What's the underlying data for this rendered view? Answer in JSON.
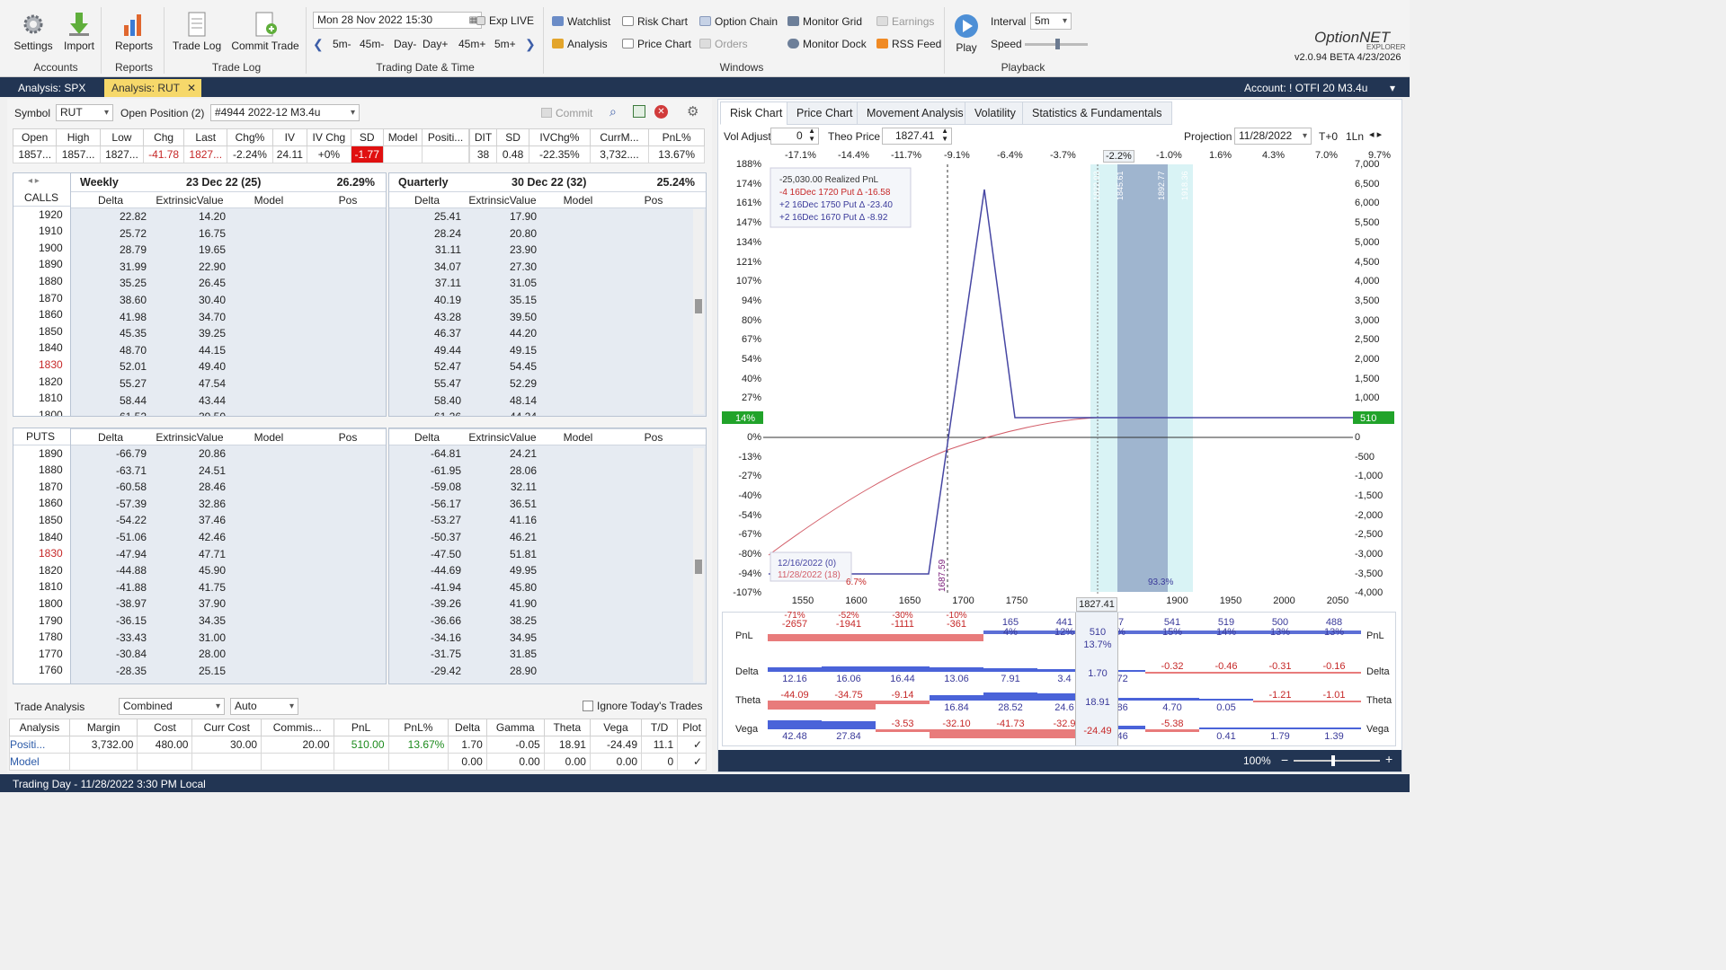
{
  "ribbon": {
    "settings": "Settings",
    "import": "Import",
    "reports": "Reports",
    "trade_log": "Trade Log",
    "commit_trade": "Commit Trade",
    "grp_accounts": "Accounts",
    "grp_reports": "Reports",
    "grp_tradelog": "Trade Log",
    "grp_datetime": "Trading Date & Time",
    "grp_windows": "Windows",
    "grp_playback": "Playback",
    "datetime": "Mon 28 Nov 2022 15:30",
    "exp_live": "Exp LIVE",
    "steps": [
      "5m-",
      "45m-",
      "Day-",
      "Day+",
      "45m+",
      "5m+"
    ],
    "watchlist": "Watchlist",
    "risk_chart": "Risk Chart",
    "option_chain": "Option Chain",
    "monitor_grid": "Monitor Grid",
    "earnings": "Earnings",
    "analysis": "Analysis",
    "price_chart": "Price Chart",
    "orders": "Orders",
    "monitor_dock": "Monitor Dock",
    "rss_feed": "RSS Feed",
    "play": "Play",
    "interval_label": "Interval",
    "interval_value": "5m",
    "speed_label": "Speed",
    "logo": "OptionNET",
    "logo_sub": "EXPLORER",
    "version": "v2.0.94 BETA 4/23/2026"
  },
  "doc_tabs": {
    "tab1": "Analysis: SPX",
    "tab2": "Analysis: RUT",
    "close": "✕",
    "account": "Account: ! OTFI 20 M3.4u"
  },
  "top": {
    "symbol_label": "Symbol",
    "symbol_value": "RUT",
    "open_pos_label": "Open Position (2)",
    "open_pos_value": "#4944 2022-12 M3.4u",
    "commit": "Commit"
  },
  "quote": {
    "headers": [
      "Open",
      "High",
      "Low",
      "Chg",
      "Last",
      "Chg%",
      "IV",
      "IV Chg",
      "SD",
      "Model",
      "Positi..."
    ],
    "values": [
      "1857...",
      "1857...",
      "1827...",
      "-41.78",
      "1827...",
      "-2.24%",
      "24.11",
      "+0%",
      "-1.77",
      "",
      ""
    ],
    "headers2": [
      "DIT",
      "SD",
      "IVChg%",
      "CurrM...",
      "PnL%"
    ],
    "values2": [
      "38",
      "0.48",
      "-22.35%",
      "3,732....",
      "13.67%"
    ]
  },
  "chain": {
    "weekly_label": "Weekly",
    "weekly_date": "23 Dec 22 (25)",
    "weekly_iv": "26.29%",
    "quarterly_label": "Quarterly",
    "quarterly_date": "30 Dec 22 (32)",
    "quarterly_iv": "25.24%",
    "calls_label": "CALLS",
    "puts_label": "PUTS",
    "col_delta": "Delta",
    "col_extrinsic": "ExtrinsicValue",
    "col_model": "Model",
    "col_pos": "Pos",
    "call_strikes": [
      "1920",
      "1910",
      "1900",
      "1890",
      "1880",
      "1870",
      "1860",
      "1850",
      "1840",
      "1830",
      "1820",
      "1810",
      "1800"
    ],
    "call_w_delta": [
      "22.82",
      "25.72",
      "28.79",
      "31.99",
      "35.25",
      "38.60",
      "41.98",
      "45.35",
      "48.70",
      "52.01",
      "55.27",
      "58.44",
      "61.52"
    ],
    "call_w_ext": [
      "14.20",
      "16.75",
      "19.65",
      "22.90",
      "26.45",
      "30.40",
      "34.70",
      "39.25",
      "44.15",
      "49.40",
      "47.54",
      "43.44",
      "39.50"
    ],
    "call_q_delta": [
      "25.41",
      "28.24",
      "31.11",
      "34.07",
      "37.11",
      "40.19",
      "43.28",
      "46.37",
      "49.44",
      "52.47",
      "55.47",
      "58.40",
      "61.26"
    ],
    "call_q_ext": [
      "17.90",
      "20.80",
      "23.90",
      "27.30",
      "31.05",
      "35.15",
      "39.50",
      "44.20",
      "49.15",
      "54.45",
      "52.29",
      "48.14",
      "44.24"
    ],
    "put_strikes": [
      "1890",
      "1880",
      "1870",
      "1860",
      "1850",
      "1840",
      "1830",
      "1820",
      "1810",
      "1800",
      "1790",
      "1780",
      "1770",
      "1760"
    ],
    "put_w_delta": [
      "-66.79",
      "-63.71",
      "-60.58",
      "-57.39",
      "-54.22",
      "-51.06",
      "-47.94",
      "-44.88",
      "-41.88",
      "-38.97",
      "-36.15",
      "-33.43",
      "-30.84",
      "-28.35"
    ],
    "put_w_ext": [
      "20.86",
      "24.51",
      "28.46",
      "32.86",
      "37.46",
      "42.46",
      "47.71",
      "45.90",
      "41.75",
      "37.90",
      "34.35",
      "31.00",
      "28.00",
      "25.15"
    ],
    "put_q_delta": [
      "-64.81",
      "-61.95",
      "-59.08",
      "-56.17",
      "-53.27",
      "-50.37",
      "-47.50",
      "-44.69",
      "-41.94",
      "-39.26",
      "-36.66",
      "-34.16",
      "-31.75",
      "-29.42"
    ],
    "put_q_ext": [
      "24.21",
      "28.06",
      "32.11",
      "36.51",
      "41.16",
      "46.21",
      "51.81",
      "49.95",
      "45.80",
      "41.90",
      "38.25",
      "34.95",
      "31.85",
      "28.90"
    ]
  },
  "trade_analysis": {
    "label": "Trade Analysis",
    "mode": "Combined",
    "auto": "Auto",
    "ignore": "Ignore Today's Trades",
    "headers": [
      "Analysis",
      "Margin",
      "Cost",
      "Curr Cost",
      "Commis...",
      "PnL",
      "PnL%",
      "Delta",
      "Gamma",
      "Theta",
      "Vega",
      "T/D",
      "Plot"
    ],
    "row1": [
      "Positi...",
      "3,732.00",
      "480.00",
      "30.00",
      "20.00",
      "510.00",
      "13.67%",
      "1.70",
      "-0.05",
      "18.91",
      "-24.49",
      "11.1",
      "✓"
    ],
    "row2": [
      "Model",
      "",
      "",
      "",
      "",
      "",
      "",
      "0.00",
      "0.00",
      "0.00",
      "0.00",
      "0",
      "✓"
    ]
  },
  "right_tabs": [
    "Risk Chart",
    "Price Chart",
    "Movement Analysis",
    "Volatility",
    "Statistics & Fundamentals"
  ],
  "risk": {
    "vol_adjust": "Vol Adjust",
    "vol_value": "0",
    "theo_label": "Theo Price",
    "theo_value": "1827.41",
    "projection_label": "Projection",
    "projection_value": "11/28/2022",
    "t0": "T+0",
    "lines": "1Ln",
    "top_pct": [
      "-17.1%",
      "-14.4%",
      "-11.7%",
      "-9.1%",
      "-6.4%",
      "-3.7%",
      "-2.2%",
      "-1.0%",
      "1.6%",
      "4.3%",
      "7.0%",
      "9.7%"
    ],
    "left_pct": [
      "188%",
      "174%",
      "161%",
      "147%",
      "134%",
      "121%",
      "107%",
      "94%",
      "80%",
      "67%",
      "54%",
      "40%",
      "27%",
      "14%",
      "0%",
      "-13%",
      "-27%",
      "-40%",
      "-54%",
      "-67%",
      "-80%",
      "-94%",
      "-107%"
    ],
    "right_vals": [
      "7,000",
      "6,500",
      "6,000",
      "5,500",
      "5,000",
      "4,500",
      "4,000",
      "3,500",
      "3,000",
      "2,500",
      "2,000",
      "1,500",
      "1,000",
      "510",
      "0",
      "-500",
      "-1,000",
      "-1,500",
      "-2,000",
      "-2,500",
      "-3,000",
      "-3,500",
      "-4,000"
    ],
    "x_labels": [
      "1550",
      "1600",
      "1650",
      "1700",
      "1750",
      "1800",
      "1850",
      "1900",
      "1950",
      "2000",
      "2050"
    ],
    "legend": [
      "-25,030.00 Realized PnL",
      "-4 16Dec 1720 Put Δ -16.58",
      "+2 16Dec 1750 Put Δ -23.40",
      "+2 16Dec 1670 Put Δ -8.92"
    ],
    "date_legend": [
      "12/16/2022 (0)",
      "11/28/2022 (18)"
    ],
    "price_marker": "1827.41",
    "bottom_left_pct": "6.7%",
    "bottom_right_pct": "93.3%",
    "breakeven": "1687.59",
    "vertical_prices": [
      "1822.03",
      "1845.61",
      "1892.77",
      "1918.36"
    ],
    "current_pnl": "510",
    "current_pct": "14%"
  },
  "greeks": {
    "labels": [
      "PnL",
      "Delta",
      "Theta",
      "Vega"
    ],
    "pnl_top": [
      "-71%",
      "-52%",
      "-30%",
      "-10%",
      "",
      "",
      "",
      "",
      "",
      "",
      ""
    ],
    "pnl_vals": [
      "-2657",
      "-1941",
      "-1111",
      "-361",
      "165\n4%",
      "441\n12%",
      "",
      "37\n4%",
      "541\n15%",
      "519\n14%",
      "500\n13%",
      "488\n13%"
    ],
    "cursor_pnl": "510",
    "cursor_pct": "13.7%",
    "cursor_delta": "1.70",
    "cursor_theta": "18.91",
    "cursor_vega": "-24.49",
    "delta_vals": [
      "12.16",
      "16.06",
      "16.44",
      "13.06",
      "7.91",
      "3.4",
      "",
      "1.72",
      "-0.32",
      "-0.46",
      "-0.31",
      "-0.16"
    ],
    "theta_vals": [
      "-44.09",
      "-34.75",
      "-9.14",
      "16.84",
      "28.52",
      "24.6",
      "",
      "3.86",
      "4.70",
      "0.05",
      "-1.21",
      "-1.01"
    ],
    "vega_vals": [
      "42.48",
      "27.84",
      "-3.53",
      "-32.10",
      "-41.73",
      "-32.9",
      "",
      "7.46",
      "-5.38",
      "0.41",
      "1.79",
      "1.39"
    ],
    "zoom": "100%"
  },
  "status": "Trading Day - 11/28/2022 3:30 PM Local"
}
